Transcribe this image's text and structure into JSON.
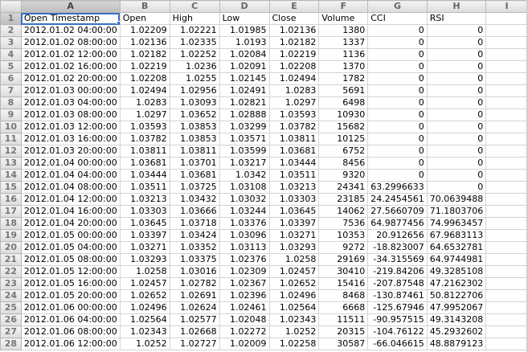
{
  "columns": [
    "A",
    "B",
    "C",
    "D",
    "E",
    "F",
    "G",
    "H",
    "I"
  ],
  "headers": [
    "Open Timestamp",
    "Open",
    "High",
    "Low",
    "Close",
    "Volume",
    "CCI",
    "RSI",
    ""
  ],
  "rows": [
    [
      "2012.01.02 04:00:00",
      "1.02209",
      "1.02221",
      "1.01985",
      "1.02136",
      "1380",
      "0",
      "0"
    ],
    [
      "2012.01.02 08:00:00",
      "1.02136",
      "1.02335",
      "1.0193",
      "1.02182",
      "1337",
      "0",
      "0"
    ],
    [
      "2012.01.02 12:00:00",
      "1.02182",
      "1.02252",
      "1.02084",
      "1.02219",
      "1136",
      "0",
      "0"
    ],
    [
      "2012.01.02 16:00:00",
      "1.02219",
      "1.0236",
      "1.02091",
      "1.02208",
      "1370",
      "0",
      "0"
    ],
    [
      "2012.01.02 20:00:00",
      "1.02208",
      "1.0255",
      "1.02145",
      "1.02494",
      "1782",
      "0",
      "0"
    ],
    [
      "2012.01.03 00:00:00",
      "1.02494",
      "1.02956",
      "1.02491",
      "1.0283",
      "5691",
      "0",
      "0"
    ],
    [
      "2012.01.03 04:00:00",
      "1.0283",
      "1.03093",
      "1.02821",
      "1.0297",
      "6498",
      "0",
      "0"
    ],
    [
      "2012.01.03 08:00:00",
      "1.0297",
      "1.03652",
      "1.02888",
      "1.03593",
      "10930",
      "0",
      "0"
    ],
    [
      "2012.01.03 12:00:00",
      "1.03593",
      "1.03853",
      "1.03299",
      "1.03782",
      "15682",
      "0",
      "0"
    ],
    [
      "2012.01.03 16:00:00",
      "1.03782",
      "1.03853",
      "1.03571",
      "1.03811",
      "10125",
      "0",
      "0"
    ],
    [
      "2012.01.03 20:00:00",
      "1.03811",
      "1.03811",
      "1.03599",
      "1.03681",
      "6752",
      "0",
      "0"
    ],
    [
      "2012.01.04 00:00:00",
      "1.03681",
      "1.03701",
      "1.03217",
      "1.03444",
      "8456",
      "0",
      "0"
    ],
    [
      "2012.01.04 04:00:00",
      "1.03444",
      "1.03681",
      "1.0342",
      "1.03511",
      "9320",
      "0",
      "0"
    ],
    [
      "2012.01.04 08:00:00",
      "1.03511",
      "1.03725",
      "1.03108",
      "1.03213",
      "24341",
      "63.2996633",
      "0"
    ],
    [
      "2012.01.04 12:00:00",
      "1.03213",
      "1.03432",
      "1.03032",
      "1.03303",
      "23185",
      "24.2454561",
      "70.0639488"
    ],
    [
      "2012.01.04 16:00:00",
      "1.03303",
      "1.03666",
      "1.03244",
      "1.03645",
      "14062",
      "27.5660709",
      "71.1803706"
    ],
    [
      "2012.01.04 20:00:00",
      "1.03645",
      "1.03718",
      "1.03376",
      "1.03397",
      "7536",
      "64.9877456",
      "74.9963457"
    ],
    [
      "2012.01.05 00:00:00",
      "1.03397",
      "1.03424",
      "1.03096",
      "1.03271",
      "10353",
      "20.912656",
      "67.9683113"
    ],
    [
      "2012.01.05 04:00:00",
      "1.03271",
      "1.03352",
      "1.03113",
      "1.03293",
      "9272",
      "-18.823007",
      "64.6532781"
    ],
    [
      "2012.01.05 08:00:00",
      "1.03293",
      "1.03375",
      "1.02376",
      "1.0258",
      "29169",
      "-34.315569",
      "64.9744981"
    ],
    [
      "2012.01.05 12:00:00",
      "1.0258",
      "1.03016",
      "1.02309",
      "1.02457",
      "30410",
      "-219.84206",
      "49.3285108"
    ],
    [
      "2012.01.05 16:00:00",
      "1.02457",
      "1.02782",
      "1.02367",
      "1.02652",
      "15416",
      "-207.87548",
      "47.2162302"
    ],
    [
      "2012.01.05 20:00:00",
      "1.02652",
      "1.02691",
      "1.02396",
      "1.02496",
      "8468",
      "-130.87461",
      "50.8122706"
    ],
    [
      "2012.01.06 00:00:00",
      "1.02496",
      "1.02624",
      "1.02461",
      "1.02564",
      "6668",
      "-125.67946",
      "47.9952067"
    ],
    [
      "2012.01.06 04:00:00",
      "1.02564",
      "1.02577",
      "1.02048",
      "1.02343",
      "11511",
      "-90.957515",
      "49.3143208"
    ],
    [
      "2012.01.06 08:00:00",
      "1.02343",
      "1.02668",
      "1.02272",
      "1.0252",
      "20315",
      "-104.76122",
      "45.2932602"
    ],
    [
      "2012.01.06 12:00:00",
      "1.0252",
      "1.02727",
      "1.02009",
      "1.02258",
      "30587",
      "-66.046615",
      "48.8879123"
    ]
  ],
  "selection": {
    "active_cell": "A1",
    "accent": "#3a6fc4"
  }
}
